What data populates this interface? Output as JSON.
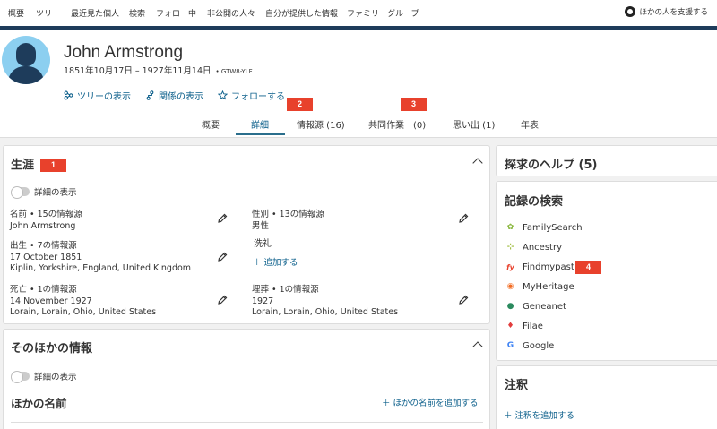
{
  "topnav": {
    "items": [
      "概要",
      "ツリー",
      "最近見た個人",
      "検索",
      "フォロー中",
      "非公開の人々",
      "自分が提供した情報",
      "ファミリーグループ"
    ],
    "help": "ほかの人を支援する"
  },
  "person": {
    "name": "John Armstrong",
    "dates": "1851年10月17日 – 1927年11月14日",
    "id": "GTW8-YLF"
  },
  "actions": {
    "tree": "ツリーの表示",
    "relationship": "関係の表示",
    "follow": "フォローする"
  },
  "tabs": [
    "概要",
    "詳細",
    "情報源 (16)",
    "共同作業　(0)",
    "思い出 (1)",
    "年表"
  ],
  "badges": [
    "1",
    "2",
    "3",
    "4"
  ],
  "life": {
    "title": "生涯",
    "toggle": "詳細の表示",
    "name": {
      "label": "名前 • 15の情報源",
      "value": "John Armstrong"
    },
    "sex": {
      "label": "性別 • 13の情報源",
      "value": "男性"
    },
    "birth": {
      "label": "出生 • 7の情報源",
      "date": "17 October 1851",
      "place": "Kiplin, Yorkshire, England, United Kingdom"
    },
    "christening": {
      "label": "洗礼",
      "add": "＋ 追加する"
    },
    "death": {
      "label": "死亡 • 1の情報源",
      "date": "14 November 1927",
      "place": "Lorain, Lorain, Ohio, United States"
    },
    "burial": {
      "label": "埋葬 • 1の情報源",
      "date": "1927",
      "place": "Lorain, Lorain, Ohio, United States"
    }
  },
  "other": {
    "title": "そのほかの情報",
    "toggle": "詳細の表示",
    "names_heading": "ほかの名前",
    "add_name": "＋ ほかの名前を追加する"
  },
  "sidebar": {
    "help_title": "探求のヘルプ (5)",
    "records_title": "記録の検索",
    "records": [
      {
        "name": "FamilySearch",
        "icon": "familysearch-icon",
        "color": "#8bb83f"
      },
      {
        "name": "Ancestry",
        "icon": "ancestry-icon",
        "color": "#9dbb3a"
      },
      {
        "name": "Findmypast",
        "icon": "findmypast-icon",
        "color": "#e8412c"
      },
      {
        "name": "MyHeritage",
        "icon": "myheritage-icon",
        "color": "#f26b21"
      },
      {
        "name": "Geneanet",
        "icon": "geneanet-icon",
        "color": "#2b8a5e"
      },
      {
        "name": "Filae",
        "icon": "filae-icon",
        "color": "#e23d3d"
      },
      {
        "name": "Google",
        "icon": "google-icon",
        "color": "#4285f4"
      }
    ],
    "notes_title": "注釈",
    "add_note": "＋ 注釈を追加する"
  },
  "colors": {
    "link": "#0a5e8a",
    "header_bar": "#1e3c5b",
    "badge": "#e8412c"
  }
}
